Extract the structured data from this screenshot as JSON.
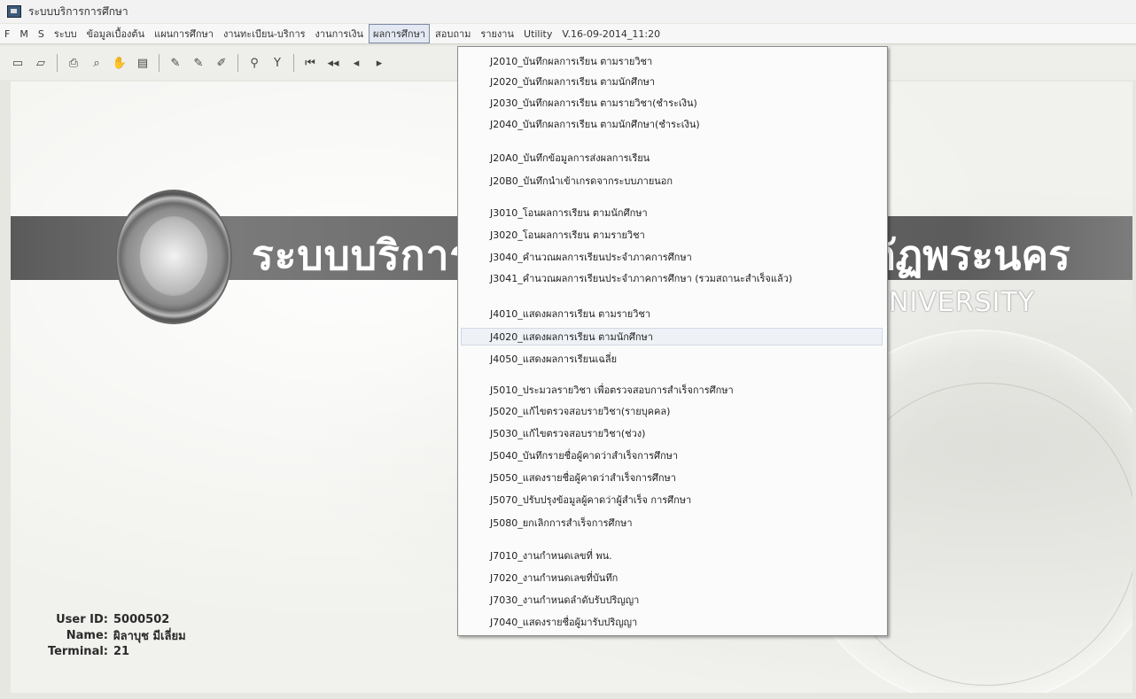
{
  "window": {
    "title": "ระบบบริการการศึกษา"
  },
  "menubar": {
    "items": [
      "F",
      "M",
      "S",
      "ระบบ",
      "ข้อมูลเบื้องต้น",
      "แผนการศึกษา",
      "งานทะเบียน-บริการ",
      "งานการเงิน",
      "ผลการศึกษา",
      "สอบถาม",
      "รายงาน",
      "Utility",
      "V.16-09-2014_11:20"
    ],
    "active_index": 8
  },
  "toolbar": {
    "icons": [
      "open-folder-icon",
      "open-file-icon",
      "print-icon",
      "preview-icon",
      "hand-icon",
      "document-icon",
      "edit-icon",
      "edit-add-icon",
      "edit-alt-icon",
      "binoculars-icon",
      "filter-icon",
      "first-record-icon",
      "prev-page-icon",
      "prev-record-icon",
      "next-record-icon"
    ]
  },
  "banner": {
    "title_left": "ระบบบริการ",
    "title_right": "ภัฏพระนคร",
    "university": "UNIVERSITY"
  },
  "dropdown": {
    "items": [
      "J2010_บันทึกผลการเรียน ตามรายวิชา",
      "J2020_บันทึกผลการเรียน ตามนักศึกษา",
      "J2030_บันทึกผลการเรียน ตามรายวิชา(ชำระเงิน)",
      "J2040_บันทึกผลการเรียน ตามนักศึกษา(ชำระเงิน)",
      "J20A0_บันทึกข้อมูลการส่งผลการเรียน",
      "J20B0_บันทึกนำเข้าเกรดจากระบบภายนอก",
      "J3010_โอนผลการเรียน ตามนักศึกษา",
      "J3020_โอนผลการเรียน ตามรายวิชา",
      "J3040_คำนวณผลการเรียนประจำภาคการศึกษา",
      "J3041_คำนวณผลการเรียนประจำภาคการศึกษา (รวมสถานะสำเร็จแล้ว)",
      "J4010_แสดงผลการเรียน ตามรายวิชา",
      "J4020_แสดงผลการเรียน ตามนักศึกษา",
      "J4050_แสดงผลการเรียนเฉลี่ย",
      "J5010_ประมวลรายวิชา เพื่อตรวจสอบการสำเร็จการศึกษา",
      "J5020_แก้ไขตรวจสอบรายวิชา(รายบุคคล)",
      "J5030_แก้ไขตรวจสอบรายวิชา(ช่วง)",
      "J5040_บันทึกรายชื่อผู้คาดว่าสำเร็จการศึกษา",
      "J5050_แสดงรายชื่อผู้คาดว่าสำเร็จการศึกษา",
      "J5070_ปรับปรุงข้อมูลผู้คาดว่าผู้สำเร็จ การศึกษา",
      "J5080_ยกเลิกการสำเร็จการศึกษา",
      "J7010_งานกำหนดเลขที่ พน.",
      "J7020_งานกำหนดเลขที่บันทึก",
      "J7030_งานกำหนดลำดับรับปริญญา",
      "J7040_แสดงรายชื่อผู้มารับปริญญา"
    ],
    "highlighted_index": 11
  },
  "user": {
    "user_id_label": "User ID:",
    "user_id": "5000502",
    "name_label": "Name:",
    "name": "ผิลาบุช มีเลี่ยม",
    "terminal_label": "Terminal:",
    "terminal": "21"
  }
}
